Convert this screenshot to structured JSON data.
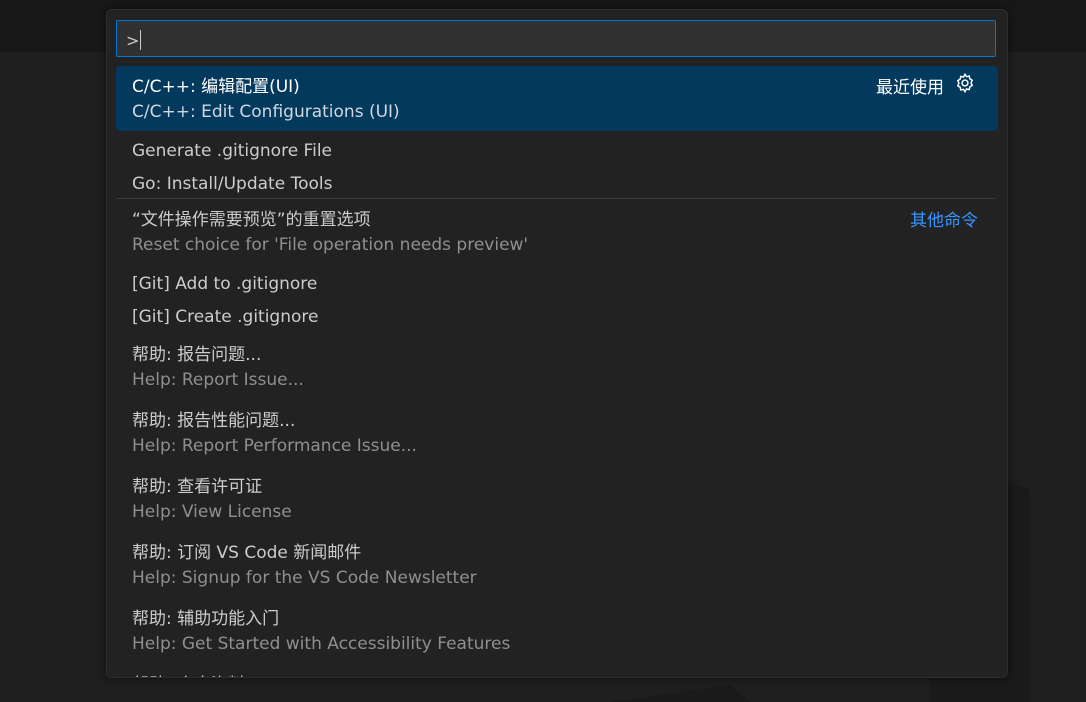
{
  "input": {
    "value": ">"
  },
  "items": [
    {
      "label": "C/C++: 编辑配置(UI)",
      "detail": "C/C++: Edit Configurations (UI)",
      "badge": "最近使用"
    },
    {
      "label": "Generate .gitignore File"
    },
    {
      "label": "Go: Install/Update Tools"
    },
    {
      "label": "“文件操作需要预览”的重置选项",
      "detail": "Reset choice for 'File operation needs preview'",
      "badge": "其他命令"
    },
    {
      "label": "[Git] Add to .gitignore"
    },
    {
      "label": "[Git] Create .gitignore"
    },
    {
      "label": "帮助: 报告问题...",
      "detail": "Help: Report Issue..."
    },
    {
      "label": "帮助: 报告性能问题...",
      "detail": "Help: Report Performance Issue..."
    },
    {
      "label": "帮助: 查看许可证",
      "detail": "Help: View License"
    },
    {
      "label": "帮助: 订阅 VS Code 新闻邮件",
      "detail": "Help: Signup for the VS Code Newsletter"
    },
    {
      "label": "帮助: 辅助功能入门",
      "detail": "Help: Get Started with Accessibility Features"
    },
    {
      "label": "帮助: 个人资料"
    }
  ],
  "colors": {
    "selection": "#04395e",
    "focus_border": "#0078d4",
    "link": "#3794ff"
  }
}
